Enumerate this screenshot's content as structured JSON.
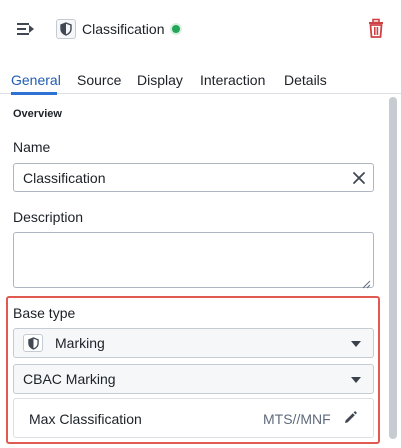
{
  "header": {
    "title": "Classification",
    "status": "active",
    "status_color": "#23a55a",
    "delete_color": "#cd4246",
    "icons": {
      "collapse": "panel-collapse-icon",
      "badge": "shield-icon",
      "delete": "trash-icon"
    }
  },
  "tabs": [
    {
      "label": "General",
      "active": true
    },
    {
      "label": "Source",
      "active": false
    },
    {
      "label": "Display",
      "active": false
    },
    {
      "label": "Interaction",
      "active": false
    },
    {
      "label": "Details",
      "active": false
    }
  ],
  "overview": {
    "section_title": "Overview",
    "name_label": "Name",
    "name_value": "Classification",
    "description_label": "Description",
    "description_value": ""
  },
  "base_type": {
    "label": "Base type",
    "selected": "Marking",
    "icon": "shield-icon",
    "subtype_selected": "CBAC Marking",
    "max_classification_label": "Max Classification",
    "max_classification_value": "MTS//MNF"
  },
  "highlight_color": "#e05a4f"
}
